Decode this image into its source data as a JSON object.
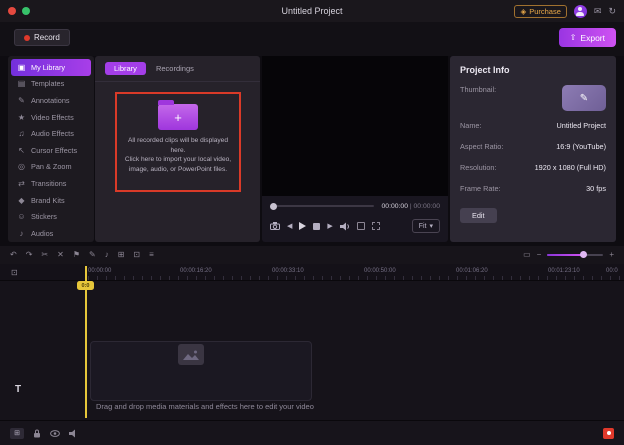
{
  "titlebar": {
    "title": "Untitled Project",
    "purchase_label": "Purchase",
    "purchase_icon_glyph": "◈",
    "icons": [
      {
        "name": "feedback-icon",
        "glyph": "✉"
      },
      {
        "name": "restore-icon",
        "glyph": "↻"
      }
    ]
  },
  "actionbar": {
    "record_label": "Record",
    "export_label": "Export",
    "export_icon_glyph": "⇧"
  },
  "sidebar": {
    "items": [
      {
        "label": "My Library",
        "icon": "my-library-icon",
        "glyph": "▣"
      },
      {
        "label": "Templates",
        "icon": "templates-icon",
        "glyph": "▤"
      },
      {
        "label": "Annotations",
        "icon": "annotations-icon",
        "glyph": "✎"
      },
      {
        "label": "Video Effects",
        "icon": "video-effects-icon",
        "glyph": "★"
      },
      {
        "label": "Audio Effects",
        "icon": "audio-effects-icon",
        "glyph": "♫"
      },
      {
        "label": "Cursor Effects",
        "icon": "cursor-effects-icon",
        "glyph": "↖"
      },
      {
        "label": "Pan & Zoom",
        "icon": "pan-zoom-icon",
        "glyph": "◎"
      },
      {
        "label": "Transitions",
        "icon": "transitions-icon",
        "glyph": "⇄"
      },
      {
        "label": "Brand Kits",
        "icon": "brand-kits-icon",
        "glyph": "◆"
      },
      {
        "label": "Stickers",
        "icon": "stickers-icon",
        "glyph": "☺"
      },
      {
        "label": "Audios",
        "icon": "audios-icon",
        "glyph": "♪"
      }
    ]
  },
  "library": {
    "tabs": [
      {
        "label": "Library"
      },
      {
        "label": "Recordings"
      }
    ],
    "folder_plus_glyph": "+",
    "empty_line1": "All recorded clips will be displayed here.",
    "empty_line2": "Click here to import your local video, image, audio, or PowerPoint files."
  },
  "preview": {
    "time_current": "00:00:00",
    "time_separator": "|",
    "time_total": "00:00:00",
    "prev_glyph": "◀",
    "next_glyph": "▶",
    "fit_label": "Fit",
    "fit_caret_glyph": "▾"
  },
  "project_info": {
    "title": "Project Info",
    "thumbnail_label": "Thumbnail:",
    "thumbnail_glyph": "✎",
    "name_label": "Name:",
    "name_value": "Untitled Project",
    "aspect_label": "Aspect Ratio:",
    "aspect_value": "16:9 (YouTube)",
    "resolution_label": "Resolution:",
    "resolution_value": "1920 x 1080 (Full HD)",
    "framerate_label": "Frame Rate:",
    "framerate_value": "30 fps",
    "edit_label": "Edit"
  },
  "timeline": {
    "tools": [
      {
        "name": "undo-icon",
        "glyph": "↶"
      },
      {
        "name": "redo-icon",
        "glyph": "↷"
      },
      {
        "name": "split-icon",
        "glyph": "✂"
      },
      {
        "name": "delete-icon",
        "glyph": "✕"
      },
      {
        "name": "marker-icon",
        "glyph": "⚑"
      },
      {
        "name": "annotation-icon",
        "glyph": "✎"
      },
      {
        "name": "voiceover-icon",
        "glyph": "♪"
      },
      {
        "name": "pip-icon",
        "glyph": "⊞"
      },
      {
        "name": "greenscreen-icon",
        "glyph": "⊡"
      },
      {
        "name": "track-manager-icon",
        "glyph": "≡"
      }
    ],
    "zoom_fit_glyph": "▭",
    "zoom_out_glyph": "−",
    "zoom_in_glyph": "+",
    "collapse_icon_glyph": "⊡",
    "ruler_ticks": [
      "00:00:00",
      "00:00:16:20",
      "00:00:33:10",
      "00:00:50:00",
      "00:01:06:20",
      "00:01:23:10",
      "00:0"
    ],
    "playhead_label": "0:0",
    "text_track_label": "T",
    "add_track_glyph": "⊞",
    "drop_hint": "Drag and drop media materials and effects here to edit your video"
  },
  "colors": {
    "accent": "#a43ee8",
    "accent_gradient_end": "#cf52f2",
    "record_red": "#e0392b",
    "import_box_red": "#d93a28",
    "playhead_yellow": "#e6c63a",
    "purchase_orange": "#e8a848"
  }
}
